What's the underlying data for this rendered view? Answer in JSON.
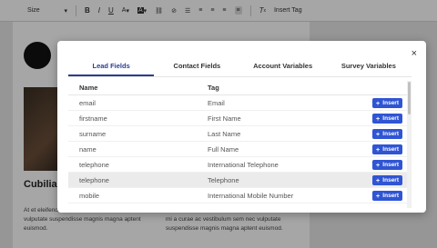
{
  "toolbar": {
    "size_label": "Size",
    "bold": "B",
    "italic": "I",
    "underline": "U",
    "font_color": "A",
    "highlight": "A",
    "clear_format": "T",
    "insert_tag": "Insert Tag"
  },
  "page": {
    "heading": "Cubilia",
    "para1": "At et eleifend, mi a curae ac vestibulum sem nec vulputate suspendisse magnis magna aptent euismod.",
    "para2": "mi a curae ac vestibulum sem nec vulputate suspendisse magnis magna aptent euismod."
  },
  "modal": {
    "close_label": "×",
    "tabs": [
      {
        "label": "Lead Fields",
        "active": true
      },
      {
        "label": "Contact Fields",
        "active": false
      },
      {
        "label": "Account Variables",
        "active": false
      },
      {
        "label": "Survey Variables",
        "active": false
      }
    ],
    "columns": {
      "name": "Name",
      "tag": "Tag"
    },
    "insert_label": "Insert",
    "rows": [
      {
        "name": "email",
        "tag": "Email",
        "highlighted": false
      },
      {
        "name": "firstname",
        "tag": "First Name",
        "highlighted": false
      },
      {
        "name": "surname",
        "tag": "Last Name",
        "highlighted": false
      },
      {
        "name": "name",
        "tag": "Full Name",
        "highlighted": false
      },
      {
        "name": "telephone",
        "tag": "International Telephone",
        "highlighted": false
      },
      {
        "name": "telephone",
        "tag": "Telephone",
        "highlighted": true
      },
      {
        "name": "mobile",
        "tag": "International Mobile Number",
        "highlighted": false
      }
    ]
  },
  "colors": {
    "accent": "#2a3e8f",
    "insert_button": "#2f55d4",
    "overlay": "rgba(0,0,0,0.35)"
  }
}
